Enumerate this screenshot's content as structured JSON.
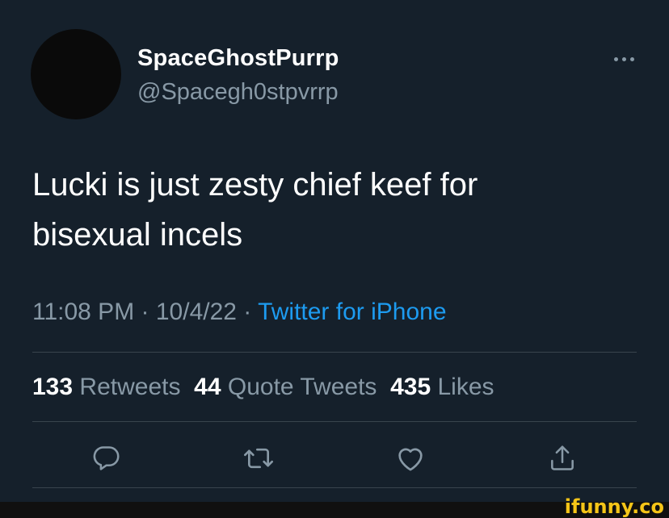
{
  "user": {
    "display_name": "SpaceGhostPurrp",
    "handle": "@Spacegh0stpvrrp"
  },
  "more_icon": "more-horizontal-icon",
  "tweet": {
    "line1": "Lucki is just zesty chief keef for",
    "line2": "bisexual incels"
  },
  "meta": {
    "time": "11:08 PM",
    "sep1": " · ",
    "date": "10/4/22",
    "sep2": " · ",
    "source": "Twitter for iPhone"
  },
  "stats": {
    "retweets_count": "133",
    "retweets_label": "Retweets",
    "quotes_count": "44",
    "quotes_label": "Quote Tweets",
    "likes_count": "435",
    "likes_label": "Likes"
  },
  "actions": [
    "reply-icon",
    "retweet-icon",
    "like-icon",
    "share-icon"
  ],
  "watermark": "ifunny.co",
  "colors": {
    "background": "#15202b",
    "secondary_text": "#8899a6",
    "link": "#1d9bf0",
    "divider": "#38444d"
  }
}
